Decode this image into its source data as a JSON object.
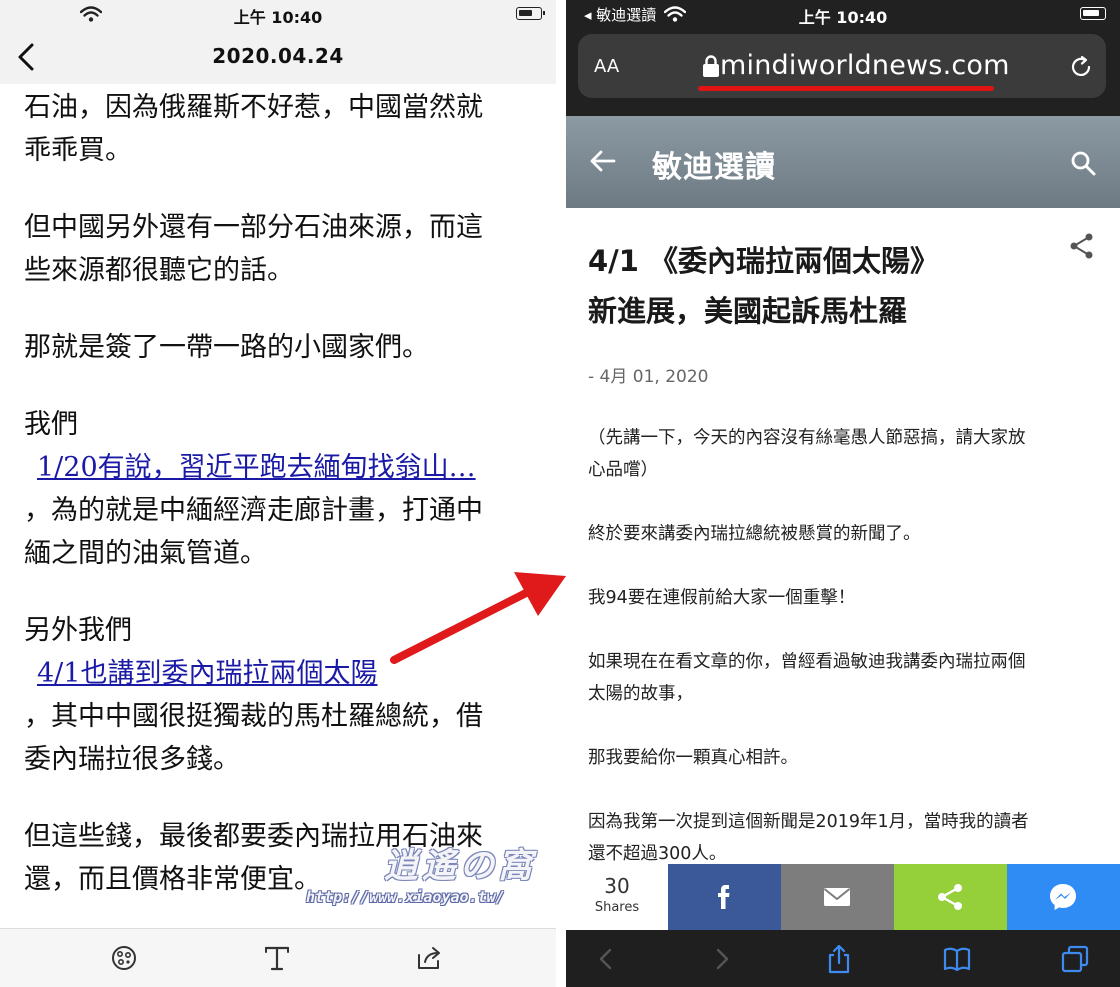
{
  "left_phone": {
    "status": {
      "time": "上午 10:40"
    },
    "nav": {
      "title": "2020.04.24"
    },
    "content": {
      "p1_l1": "石油，因為俄羅斯不好惹，中國當然就",
      "p1_l2": "乖乖買。",
      "p2_l1": "但中國另外還有一部分石油來源，而這",
      "p2_l2": "些來源都很聽它的話。",
      "p3": "那就是簽了一帶一路的小國家們。",
      "p4_label": "我們",
      "p4_link": "1/20有說，習近平跑去緬甸找翁山…",
      "p4_l2": "，為的就是中緬經濟走廊計畫，打通中",
      "p4_l3": "緬之間的油氣管道。",
      "p5_label": "另外我們",
      "p5_link": "4/1也講到委內瑞拉兩個太陽",
      "p5_l2": "，其中中國很挺獨裁的馬杜羅總統，借",
      "p5_l3": "委內瑞拉很多錢。",
      "p6_l1": "但這些錢，最後都要委內瑞拉用石油來",
      "p6_l2": "還，而且價格非常便宜。"
    },
    "toolbar": {
      "icons": [
        "reader-theme-icon",
        "text-format-icon",
        "share-icon"
      ]
    }
  },
  "right_phone": {
    "status": {
      "carrier": "◂ 敏迪選讀",
      "time": "上午 10:40"
    },
    "urlbar": {
      "aa": "AA",
      "url": "mindiworldnews.com"
    },
    "header": {
      "site_name": "敏迪選讀"
    },
    "article": {
      "title_l1": "4/1 《委內瑞拉兩個太陽》",
      "title_l2": "新進展，美國起訴馬杜羅",
      "date": "- 4月 01, 2020",
      "b1_l1": "（先講一下，今天的內容沒有絲毫愚人節惡搞，請大家放",
      "b1_l2": "心品嚐）",
      "b2": "終於要來講委內瑞拉總統被懸賞的新聞了。",
      "b3": "我94要在連假前給大家一個重擊！",
      "b4_l1": "如果現在在看文章的你，曾經看過敏迪我講委內瑞拉兩個",
      "b4_l2": "太陽的故事，",
      "b5": "那我要給你一顆真心相許。",
      "b6_l1": "因為我第一次提到這個新聞是2019年1月，當時我的讀者",
      "b6_l2": "還不超過300人。"
    },
    "sharebar": {
      "count": "30",
      "count_label": "Shares",
      "buttons": [
        {
          "name": "facebook",
          "color": "#3b5998"
        },
        {
          "name": "email",
          "color": "#7d7d7d"
        },
        {
          "name": "sharethis",
          "color": "#95d03a"
        },
        {
          "name": "messenger",
          "color": "#2f8cf4"
        }
      ]
    }
  },
  "watermark": {
    "logo": "逍遙の窩",
    "url": "http://www.xiaoyao.tw/"
  },
  "colors": {
    "link": "#1a1aa6",
    "arrow": "#e01a1a",
    "url_underline": "#e01414",
    "dark_chrome": "#212121"
  }
}
